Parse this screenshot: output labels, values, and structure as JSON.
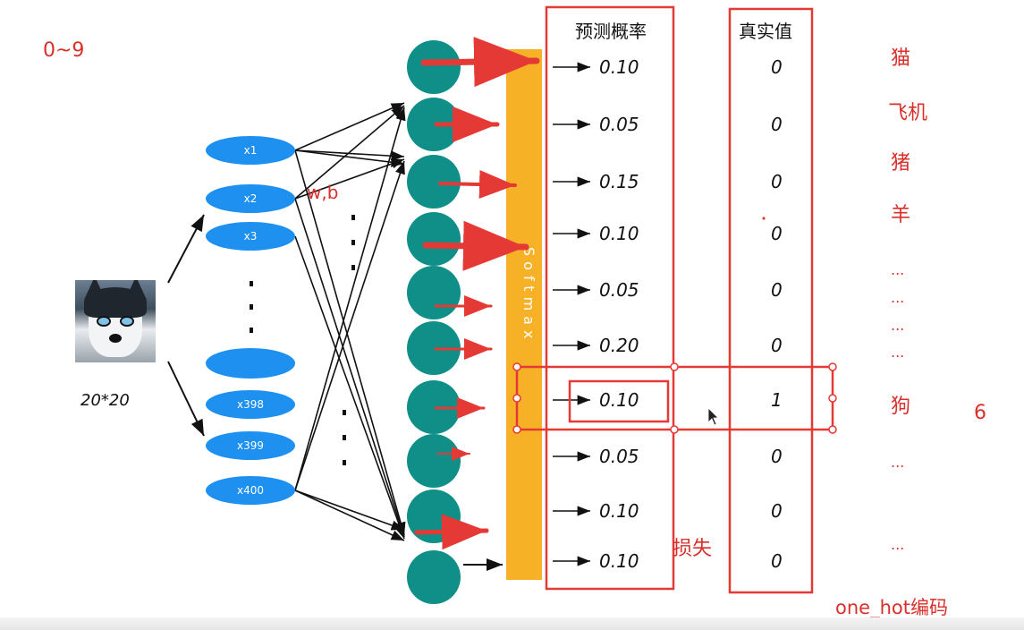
{
  "class_range": "0~9",
  "input_size": "20*20",
  "weights_label": "w,b",
  "softmax_label": "Softmax",
  "input_nodes": [
    "x1",
    "x2",
    "x3",
    "",
    "x398",
    "x399",
    "x400"
  ],
  "prob_header": "预测概率",
  "true_header": "真实值",
  "probabilities": [
    "0.10",
    "0.05",
    "0.15",
    "0.10",
    "0.05",
    "0.20",
    "0.10",
    "0.05",
    "0.10",
    "0.10"
  ],
  "true_values": [
    "0",
    "0",
    "0",
    "0",
    "0",
    "0",
    "1",
    "0",
    "0",
    "0"
  ],
  "class_labels": [
    "猫",
    "飞机",
    "猪",
    "羊",
    "...",
    "...",
    "...",
    "...",
    "狗",
    "...",
    "..."
  ],
  "dog_index": "6",
  "loss_label": "损失",
  "encoding_label": "one_hot编码",
  "colors": {
    "teal": "#0f8f88",
    "blue": "#1e90f0",
    "orange": "#f7b126",
    "red": "#d9302b"
  }
}
